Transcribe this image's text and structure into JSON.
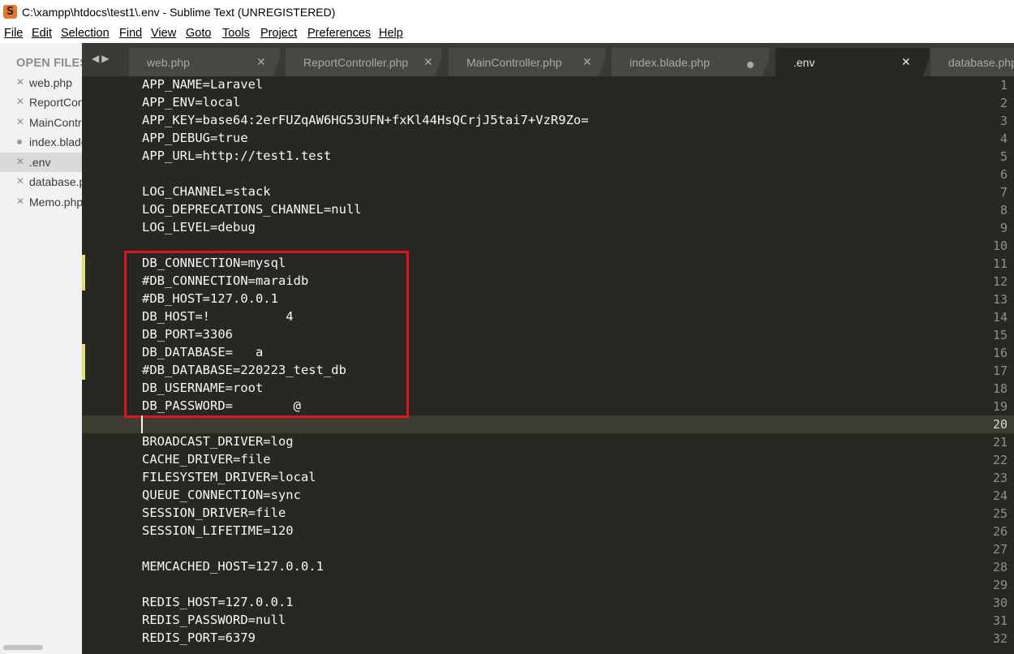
{
  "window": {
    "title": "C:\\xampp\\htdocs\\test1\\.env - Sublime Text (UNREGISTERED)",
    "icon": "sublime-text-logo"
  },
  "menu": [
    "File",
    "Edit",
    "Selection",
    "Find",
    "View",
    "Goto",
    "Tools",
    "Project",
    "Preferences",
    "Help"
  ],
  "sidebar": {
    "header": "OPEN FILES",
    "items": [
      {
        "label": "web.php",
        "marker": "close"
      },
      {
        "label": "ReportController.php",
        "marker": "close"
      },
      {
        "label": "MainController.php",
        "marker": "close"
      },
      {
        "label": "index.blade.php",
        "marker": "dirty"
      },
      {
        "label": ".env",
        "marker": "close",
        "active": true
      },
      {
        "label": "database.php",
        "marker": "close"
      },
      {
        "label": "Memo.php",
        "marker": "close"
      }
    ]
  },
  "tabs": [
    {
      "label": "web.php",
      "state": "close"
    },
    {
      "label": "ReportController.php",
      "state": "close"
    },
    {
      "label": "MainController.php",
      "state": "close"
    },
    {
      "label": "index.blade.php",
      "state": "dirty"
    },
    {
      "label": ".env",
      "state": "close",
      "active": true
    },
    {
      "label": "database.php",
      "state": "close"
    }
  ],
  "editor": {
    "current_line": 20,
    "modified_lines": [
      11,
      12,
      16,
      17
    ],
    "lines": [
      "APP_NAME=Laravel",
      "APP_ENV=local",
      "APP_KEY=base64:2erFUZqAW6HG53UFN+fxKl44HsQCrjJ5tai7+VzR9Zo=",
      "APP_DEBUG=true",
      "APP_URL=http://test1.test",
      "",
      "LOG_CHANNEL=stack",
      "LOG_DEPRECATIONS_CHANNEL=null",
      "LOG_LEVEL=debug",
      "",
      "DB_CONNECTION=mysql",
      "#DB_CONNECTION=maraidb",
      "#DB_HOST=127.0.0.1",
      "DB_HOST=!          4",
      "DB_PORT=3306",
      "DB_DATABASE=   a",
      "#DB_DATABASE=220223_test_db",
      "DB_USERNAME=root",
      "DB_PASSWORD=        @",
      "",
      "BROADCAST_DRIVER=log",
      "CACHE_DRIVER=file",
      "FILESYSTEM_DRIVER=local",
      "QUEUE_CONNECTION=sync",
      "SESSION_DRIVER=file",
      "SESSION_LIFETIME=120",
      "",
      "MEMCACHED_HOST=127.0.0.1",
      "",
      "REDIS_HOST=127.0.0.1",
      "REDIS_PASSWORD=null",
      "REDIS_PORT=6379"
    ]
  },
  "colors": {
    "editor_bg": "#272822",
    "editor_text": "#f8f8f2",
    "gutter_text": "#90908a",
    "modified_marker": "#e6db74",
    "annotation_box": "#e0141e",
    "tabbar_bg": "#3a3b37"
  }
}
